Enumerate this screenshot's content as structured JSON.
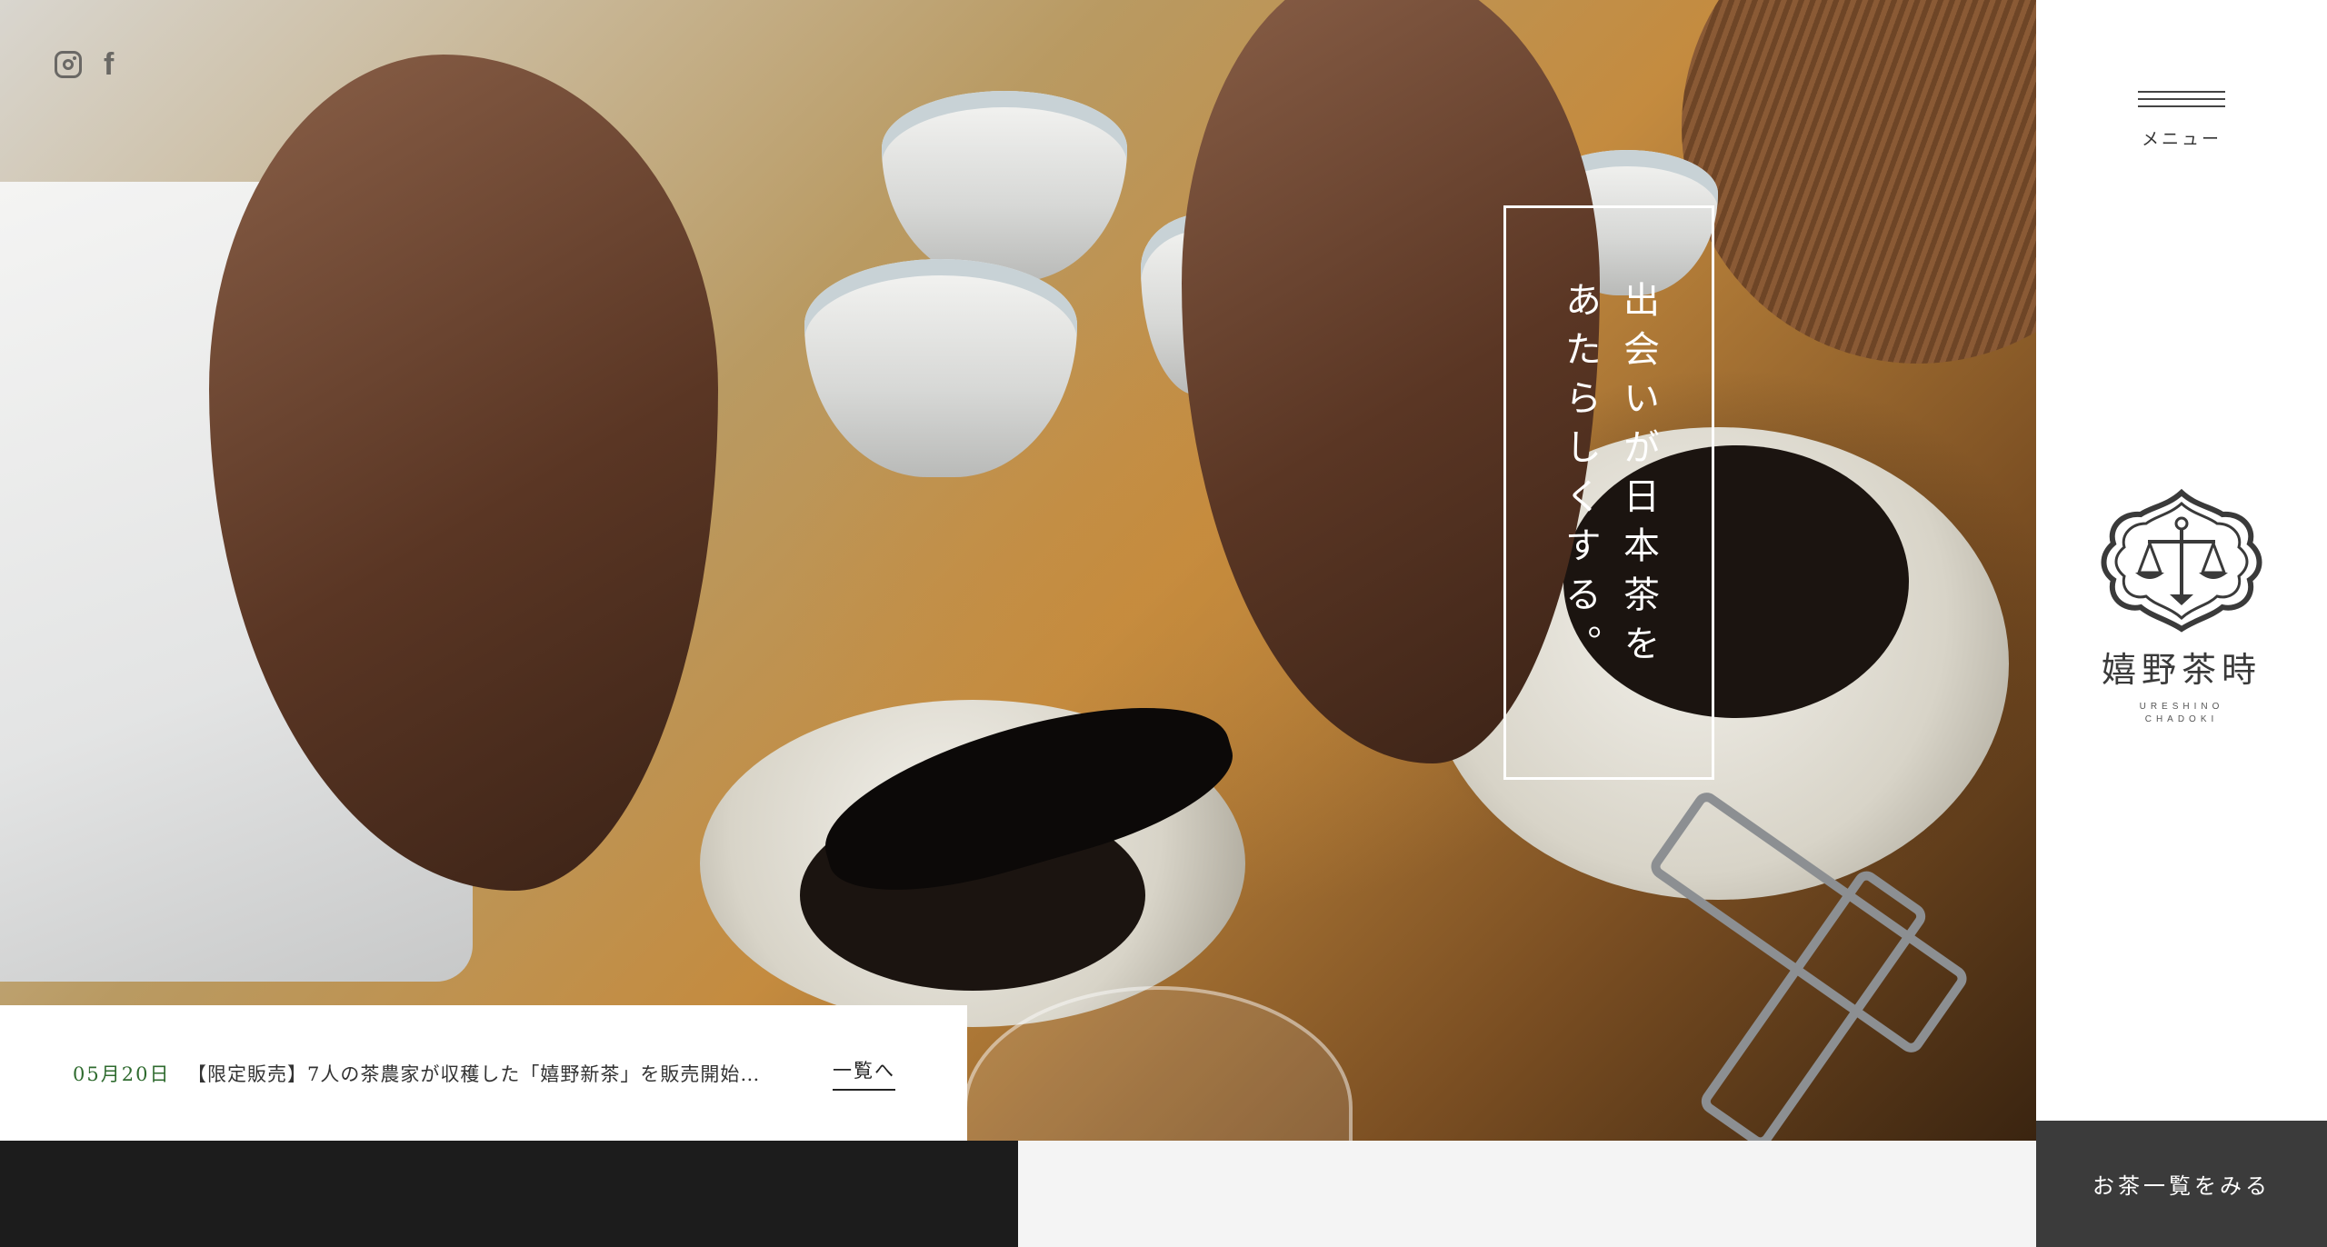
{
  "social": {
    "instagram_icon": "instagram-icon",
    "facebook_label": "f"
  },
  "hero": {
    "catch_lines": [
      "出会いが日本茶を",
      "あたらしくする。"
    ]
  },
  "news": {
    "date": "05月20日",
    "title": "【限定販売】7人の茶農家が収穫した「嬉野新茶」を販売開始…",
    "more_label": "一覧へ"
  },
  "sidebar": {
    "menu_label": "メニュー",
    "logo_name": "嬉野茶時",
    "logo_roman_1": "URESHINO",
    "logo_roman_2": "CHADOKI"
  },
  "cta": {
    "tea_list_label": "お茶一覧をみる"
  },
  "colors": {
    "news_date": "#2f6b2f",
    "cta_bg": "#3b3b3b",
    "footer_dark": "#1c1c1c"
  }
}
